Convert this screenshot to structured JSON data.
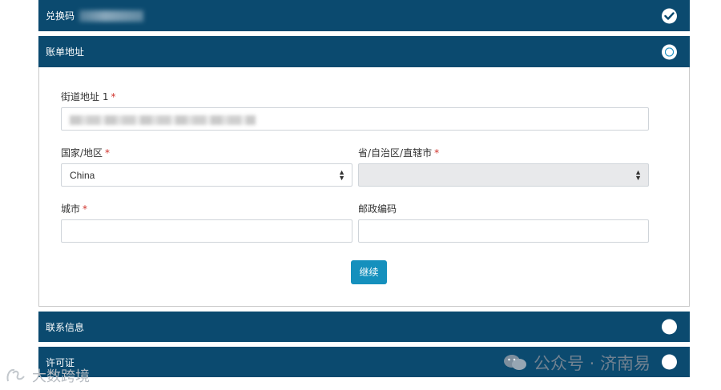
{
  "sections": {
    "redeem": {
      "title": "兑换码"
    },
    "billing": {
      "title": "账单地址"
    },
    "contact": {
      "title": "联系信息"
    },
    "license": {
      "title": "许可证"
    }
  },
  "form": {
    "street_label": "街道地址 1",
    "country_label": "国家/地区",
    "country_value": "China",
    "province_label": "省/自治区/直辖市",
    "city_label": "城市",
    "zip_label": "邮政编码",
    "required_mark": "*",
    "continue_label": "继续"
  },
  "watermarks": {
    "right": "公众号 · 济南易",
    "left": "大数跨境"
  },
  "colors": {
    "header_bg": "#0b4a6f",
    "button_bg": "#1590bd",
    "required": "#d0322b"
  }
}
